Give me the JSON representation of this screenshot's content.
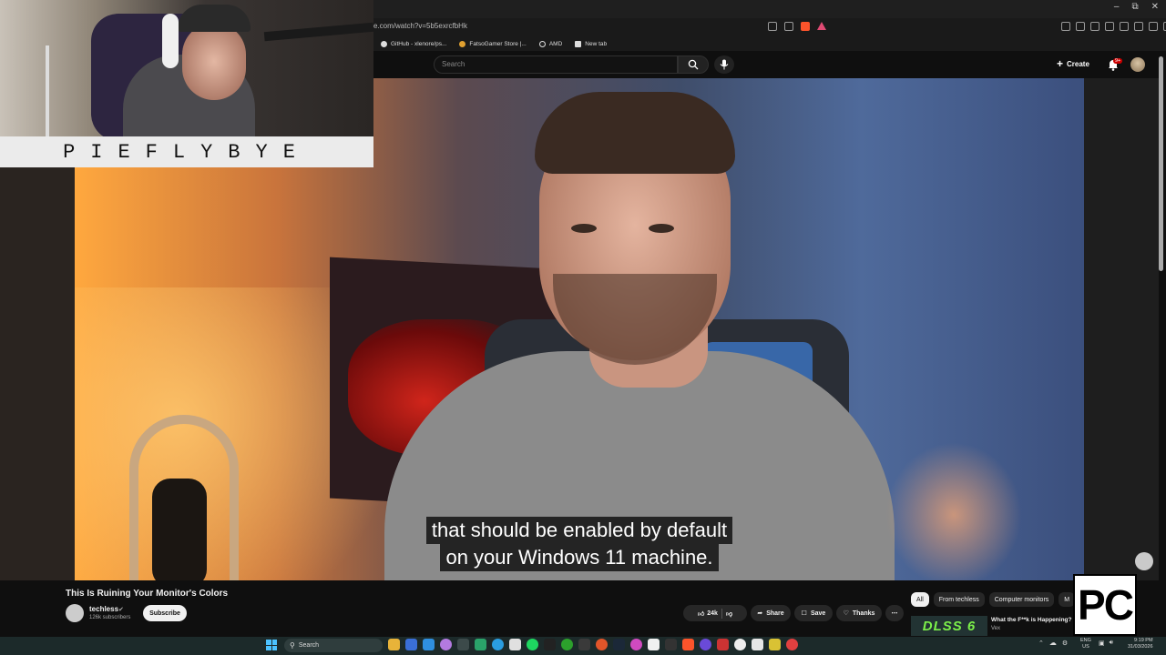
{
  "browser": {
    "url": "e.com/watch?v=5b5exrcfbHk",
    "bookmarks": [
      {
        "label": "GitHub - xlenore/ps...",
        "icon": "github-icon"
      },
      {
        "label": "FatsoGamer Store |...",
        "icon": "store-icon"
      },
      {
        "label": "AMD",
        "icon": "amd-icon"
      },
      {
        "label": "New tab",
        "icon": "page-icon"
      }
    ]
  },
  "youtube": {
    "search_placeholder": "Search",
    "create_label": "Create",
    "notification_badge": "9+",
    "video": {
      "subtitle_line1": "that should be enabled by default",
      "subtitle_line2": "on your Windows 11 machine."
    },
    "title": "This Is Ruining Your Monitor's Colors",
    "channel": {
      "name": "techless",
      "subscribers": "126k subscribers",
      "subscribe_label": "Subscribe"
    },
    "actions": {
      "likes": "24k",
      "share": "Share",
      "save": "Save",
      "thanks": "Thanks",
      "more": "⋯"
    },
    "chips": [
      "All",
      "From techless",
      "Computer monitors",
      "M"
    ],
    "recommendation": {
      "thumb_text": "DLSS 6",
      "title": "What the F**k is Happening?",
      "channel": "Vex"
    }
  },
  "overlay": {
    "streamer_name": "PIEFLYBYE",
    "corner_logo": "PC"
  },
  "taskbar": {
    "search_label": "Search",
    "lang_line1": "ENG",
    "lang_line2": "US",
    "time": "9:19 PM",
    "date": "31/03/2026"
  },
  "colors": {
    "yt_bg": "#0f0f0f",
    "chip_bg": "#272727",
    "accent_red": "#cc0000",
    "taskbar_bg": "#1c2a2a"
  }
}
